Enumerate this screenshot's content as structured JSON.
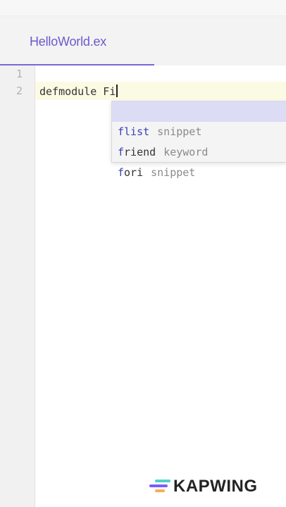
{
  "editor": {
    "tab_title": "HelloWorld.ex",
    "line_numbers": [
      "1",
      "2"
    ],
    "code_line_2": "defmodule Fi"
  },
  "suggestions": [
    {
      "match": "f",
      "rest": "list",
      "kind": "snippet",
      "selected": true
    },
    {
      "match": "f",
      "rest": "riend",
      "kind": "keyword",
      "selected": false
    },
    {
      "match": "f",
      "rest": "ori",
      "kind": "snippet",
      "selected": false
    }
  ],
  "watermark": {
    "text": "KAPWING",
    "colors": [
      "#4fd1c5",
      "#7c5cff",
      "#f6ad55"
    ]
  },
  "colors": {
    "accent": "#7b68d6",
    "suggest_match": "#3a3fb8",
    "selected_bg": "#dcdcf5"
  }
}
